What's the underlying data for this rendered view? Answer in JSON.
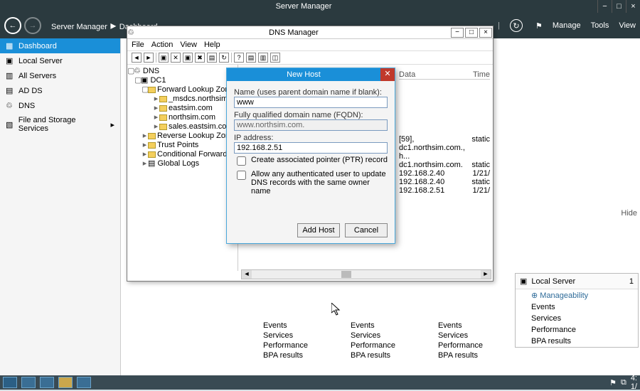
{
  "sm": {
    "title": "Server Manager",
    "crumb1": "Server Manager",
    "crumb2": "Dashboard",
    "menu": {
      "manage": "Manage",
      "tools": "Tools",
      "view": "View"
    }
  },
  "sidebar": {
    "items": [
      {
        "label": "Dashboard",
        "icon": "▦"
      },
      {
        "label": "Local Server",
        "icon": "▣"
      },
      {
        "label": "All Servers",
        "icon": "▥"
      },
      {
        "label": "AD DS",
        "icon": "▤"
      },
      {
        "label": "DNS",
        "icon": "♲"
      },
      {
        "label": "File and Storage Services",
        "icon": "▧",
        "arrow": "▸"
      }
    ]
  },
  "dns": {
    "title": "DNS Manager",
    "menu": {
      "file": "File",
      "action": "Action",
      "view": "View",
      "help": "Help"
    },
    "tree": {
      "root": "DNS",
      "server": "DC1",
      "flz": "Forward Lookup Zones",
      "z1": "_msdcs.northsim.com",
      "z2": "eastsim.com",
      "z3": "northsim.com",
      "z4": "sales.eastsim.com",
      "rlz": "Reverse Lookup Zones",
      "tp": "Trust Points",
      "cf": "Conditional Forwarders",
      "gl": "Global Logs"
    },
    "list": {
      "hdr_data": "Data",
      "hdr_time": "Time",
      "r1d": "[59], dc1.northsim.com., h...",
      "r1t": "static",
      "r2d": "dc1.northsim.com.",
      "r2t": "static",
      "r3d": "192.168.2.40",
      "r3t": "1/21/",
      "r4d": "192.168.2.40",
      "r4t": "static",
      "r5d": "192.168.2.51",
      "r5t": "1/21/"
    },
    "hide": "Hide"
  },
  "nh": {
    "title": "New Host",
    "name_lbl": "Name (uses parent domain name if blank):",
    "name_val": "www",
    "fqdn_lbl": "Fully qualified domain name (FQDN):",
    "fqdn_val": "www.northsim.com.",
    "ip_lbl": "IP address:",
    "ip_val": "192.168.2.51",
    "chk1": "Create associated pointer (PTR) record",
    "chk2": "Allow any authenticated user to update DNS records with the same owner name",
    "btn_add": "Add Host",
    "btn_cancel": "Cancel"
  },
  "tiles": {
    "local": "Local Server",
    "one": "1",
    "manage": "Manageability",
    "rows": [
      "Events",
      "Services",
      "Performance",
      "BPA results"
    ]
  },
  "cols": {
    "c": [
      "Events",
      "Services",
      "Performance",
      "BPA results"
    ]
  }
}
